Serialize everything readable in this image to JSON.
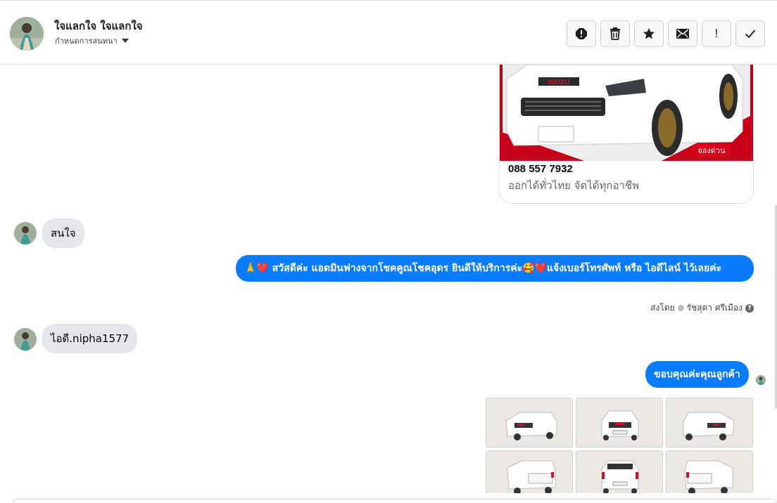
{
  "header": {
    "contact_name": "ใจแลกใจ ใจแลกใจ",
    "conversation_settings_label": "กำหนดการสนทนา",
    "actions": [
      {
        "name": "report-spam-button",
        "icon": "alert-circle-icon"
      },
      {
        "name": "delete-button",
        "icon": "trash-icon"
      },
      {
        "name": "star-button",
        "icon": "star-icon"
      },
      {
        "name": "mark-unread-button",
        "icon": "envelope-icon"
      },
      {
        "name": "follow-up-button",
        "icon": "exclamation-icon",
        "text": "!"
      },
      {
        "name": "mark-done-button",
        "icon": "check-icon"
      }
    ]
  },
  "ad_card": {
    "brand": "ISUZU",
    "badge": "จองด่วน",
    "phone": "088 557 7932",
    "subtitle": "ออกได้ทั่วไทย จัดได้ทุกอาชีพ"
  },
  "messages": {
    "incoming_1": "สนใจ",
    "outgoing_1": "🙏❤️ สวัสดีค่ะ แอดมินฟางจากโชคคูณโชคอุดร ยินดีให้บริการค่ะ🥰❤️แจ้งเบอร์โทรศัพท์ หรือ ไอดีไลน์  ไว้เลยค่ะ",
    "sent_by_prefix": "ส่งโดย",
    "sent_by_name": "รัชสุดา ศรีเมือง",
    "incoming_2": "ไอดี.nipha1577",
    "outgoing_2": "ขอบคุณค่ะคุณลูกค้า"
  },
  "photos": [
    {
      "view": "front-left"
    },
    {
      "view": "front"
    },
    {
      "view": "front-right"
    },
    {
      "view": "rear-left"
    },
    {
      "view": "rear"
    },
    {
      "view": "rear-right"
    }
  ],
  "colors": {
    "accent": "#0a7cff",
    "incoming_bubble": "#e4e6eb",
    "badge": "#d8001b"
  }
}
